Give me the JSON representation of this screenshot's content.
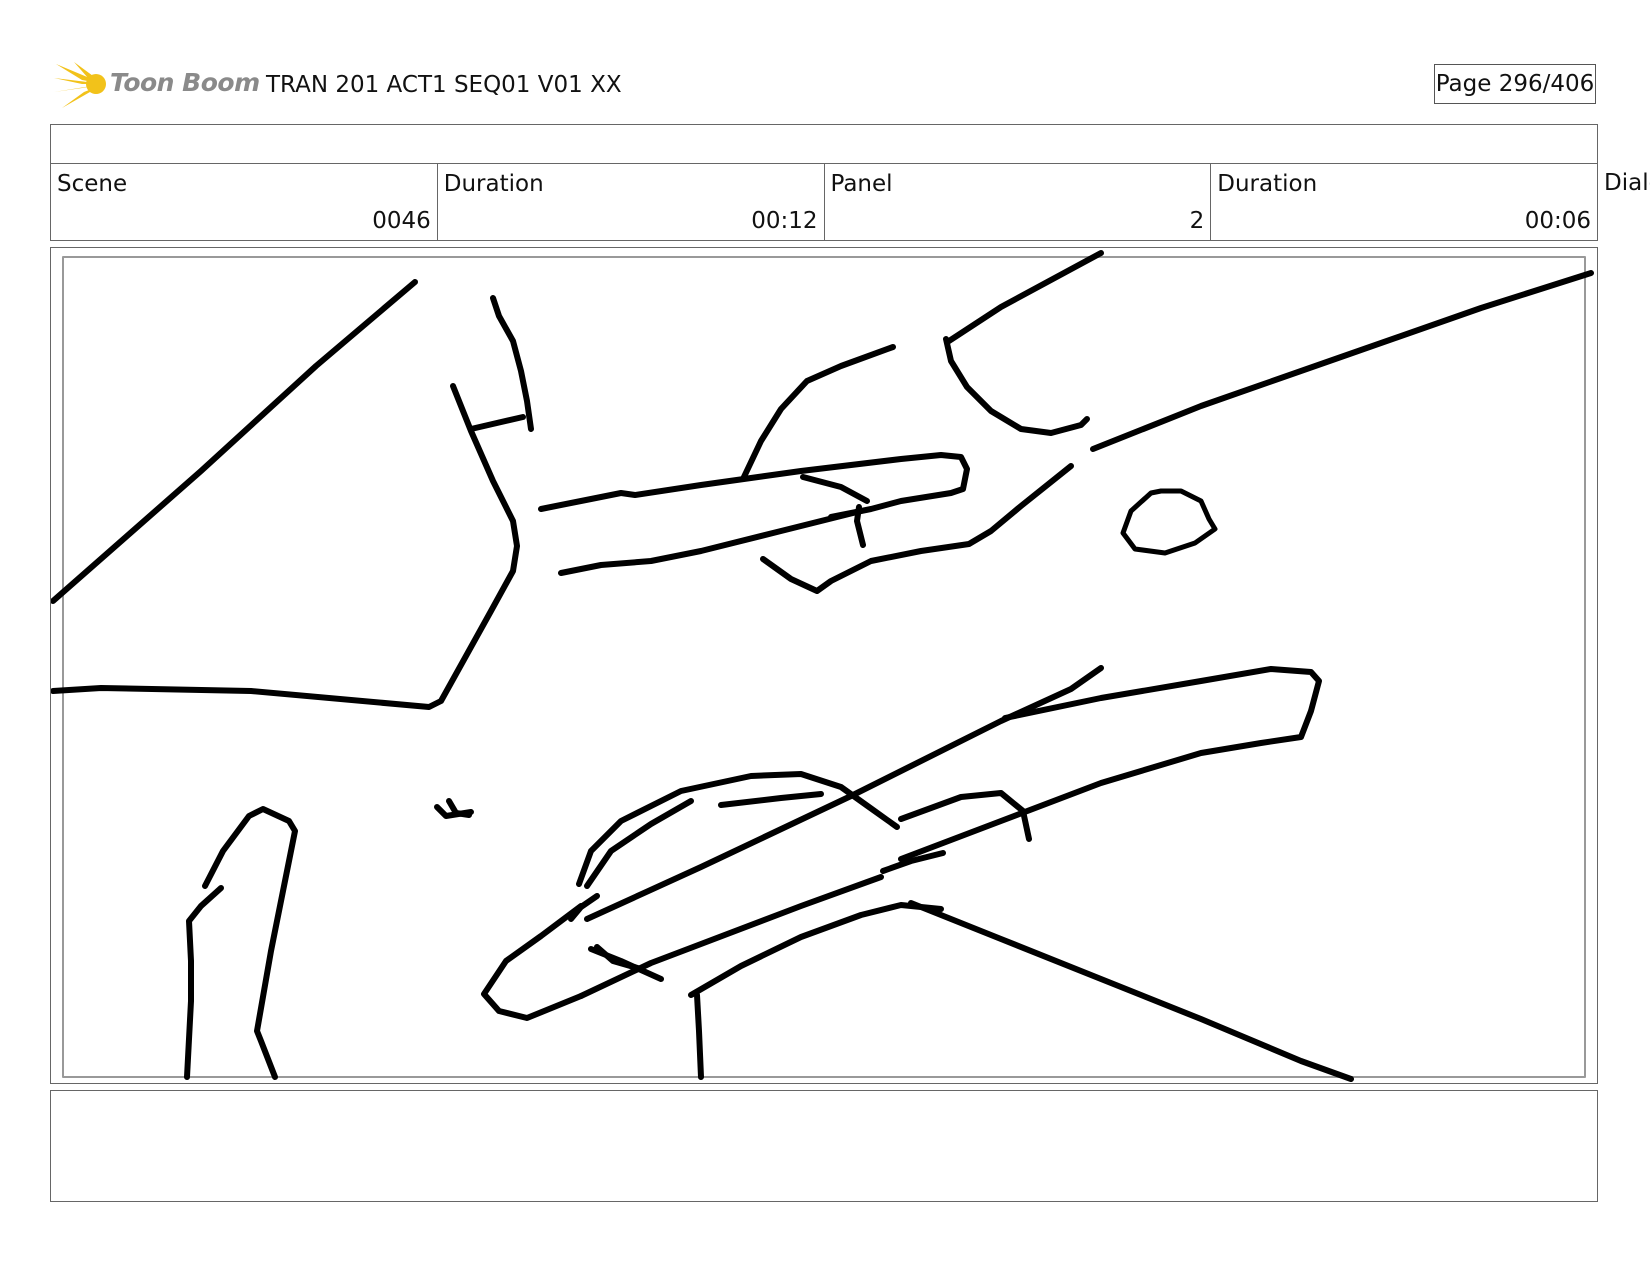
{
  "header": {
    "brand": "Toon Boom",
    "title": "TRAN 201 ACT1 SEQ01 V01 XX",
    "page": "Page 296/406"
  },
  "info": {
    "scene_label": "Scene",
    "scene_value": "0046",
    "scene_duration_label": "Duration",
    "scene_duration_value": "00:12",
    "panel_label": "Panel",
    "panel_value": "2",
    "panel_duration_label": "Duration",
    "panel_duration_value": "00:06",
    "dialog_label": "Dialo"
  },
  "colors": {
    "logo_star": "#f2c21a",
    "logo_text": "#8a8a8a",
    "ink": "#000000"
  }
}
